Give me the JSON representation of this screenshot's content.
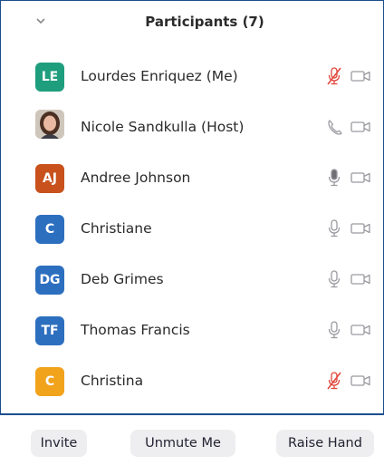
{
  "header": {
    "title": "Participants (7)",
    "collapse_icon": "chevron-down-icon"
  },
  "participants": [
    {
      "initials": "LE",
      "name": "Lourdes Enriquez (Me)",
      "avatar_color": "#1f9e7e",
      "audio": "muted",
      "video": "off"
    },
    {
      "initials": "",
      "name": "Nicole Sandkulla (Host)",
      "avatar_color": "#d9d2c8",
      "audio": "phone",
      "video": "off",
      "has_photo": true
    },
    {
      "initials": "AJ",
      "name": "Andree Johnson",
      "avatar_color": "#c8511c",
      "audio": "speaking",
      "video": "off"
    },
    {
      "initials": "C",
      "name": "Christiane",
      "avatar_color": "#2d6fbf",
      "audio": "unmuted",
      "video": "off"
    },
    {
      "initials": "DG",
      "name": "Deb Grimes",
      "avatar_color": "#2d6fbf",
      "audio": "unmuted",
      "video": "off"
    },
    {
      "initials": "TF",
      "name": "Thomas Francis",
      "avatar_color": "#2d6fbf",
      "audio": "unmuted",
      "video": "off"
    },
    {
      "initials": "C",
      "name": "Christina",
      "avatar_color": "#f1a31c",
      "audio": "muted",
      "video": "off"
    }
  ],
  "footer": {
    "invite_label": "Invite",
    "unmute_label": "Unmute Me",
    "raise_hand_label": "Raise Hand"
  },
  "colors": {
    "border": "#1a4f8c",
    "muted_icon": "#e0463a",
    "icon_gray": "#9a9aa0",
    "button_bg": "#eeeef0"
  }
}
